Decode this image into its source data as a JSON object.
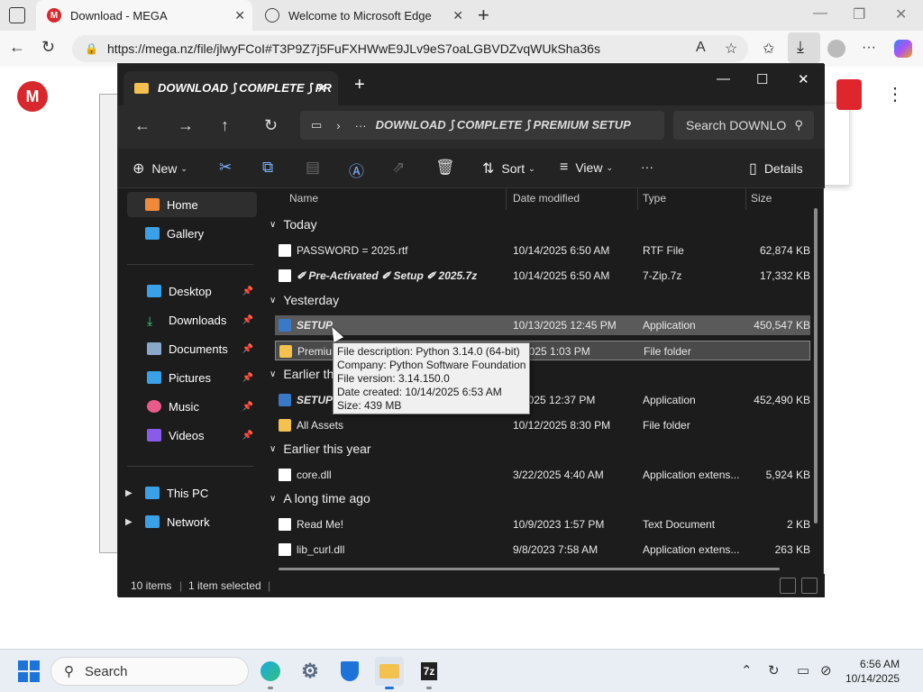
{
  "browser": {
    "tabs": [
      {
        "label": "Download - MEGA"
      },
      {
        "label": "Welcome to Microsoft Edge"
      }
    ],
    "url": "https://mega.nz/file/jlwyFCoI#T3P9Z7j5FuFXHWwE9JLv9eS7oaLGBVDZvqWUkSha36s"
  },
  "explorer": {
    "tab_title": "DOWNLOAD ⟆ COMPLETE ⟆ PR",
    "breadcrumb": "DOWNLOAD ⟆ COMPLETE ⟆ PREMIUM SETUP",
    "search_placeholder": "Search DOWNLO",
    "commands": {
      "new": "New",
      "sort": "Sort",
      "view": "View",
      "details": "Details"
    },
    "sidebar": {
      "home": "Home",
      "gallery": "Gallery",
      "desktop": "Desktop",
      "downloads": "Downloads",
      "documents": "Documents",
      "pictures": "Pictures",
      "music": "Music",
      "videos": "Videos",
      "this_pc": "This PC",
      "network": "Network"
    },
    "columns": {
      "name": "Name",
      "date": "Date modified",
      "type": "Type",
      "size": "Size"
    },
    "groups": {
      "today": "Today",
      "yesterday": "Yesterday",
      "earlier_week": "Earlier th",
      "earlier_year": "Earlier this year",
      "long_ago": "A long time ago"
    },
    "files": [
      {
        "name": "PASSWORD =  2025.rtf",
        "date": "10/14/2025 6:50 AM",
        "type": "RTF File",
        "size": "62,874 KB"
      },
      {
        "name": "✐ Pre-Activated ✐ Setup ✐ 2025.7z",
        "date": "10/14/2025 6:50 AM",
        "type": "7-Zip.7z",
        "size": "17,332 KB"
      },
      {
        "name": "SETUP",
        "date": "10/13/2025 12:45 PM",
        "type": "Application",
        "size": "450,547 KB"
      },
      {
        "name": "Premiu",
        "date": "3/2025 1:03 PM",
        "type": "File folder",
        "size": ""
      },
      {
        "name": "SETUP",
        "date": "2/2025 12:37 PM",
        "type": "Application",
        "size": "452,490 KB"
      },
      {
        "name": "All Assets",
        "date": "10/12/2025 8:30 PM",
        "type": "File folder",
        "size": ""
      },
      {
        "name": "core.dll",
        "date": "3/22/2025 4:40 AM",
        "type": "Application extens...",
        "size": "5,924 KB"
      },
      {
        "name": "Read Me!",
        "date": "10/9/2023 1:57 PM",
        "type": "Text Document",
        "size": "2 KB"
      },
      {
        "name": "lib_curl.dll",
        "date": "9/8/2023 7:58 AM",
        "type": "Application extens...",
        "size": "263 KB"
      }
    ],
    "tooltip": {
      "description": "File description: Python 3.14.0 (64-bit)",
      "company": "Company: Python Software Foundation",
      "version": "File version: 3.14.150.0",
      "created": "Date created: 10/14/2025 6:53 AM",
      "size": "Size: 439 MB"
    },
    "status": {
      "items": "10 items",
      "selected": "1 item selected"
    }
  },
  "taskbar": {
    "search": "Search",
    "time": "6:56 AM",
    "date": "10/14/2025"
  },
  "colors": {
    "mega_red": "#d9272e",
    "explorer_bg": "#1c1c1c",
    "accent": "#1e73d8"
  }
}
